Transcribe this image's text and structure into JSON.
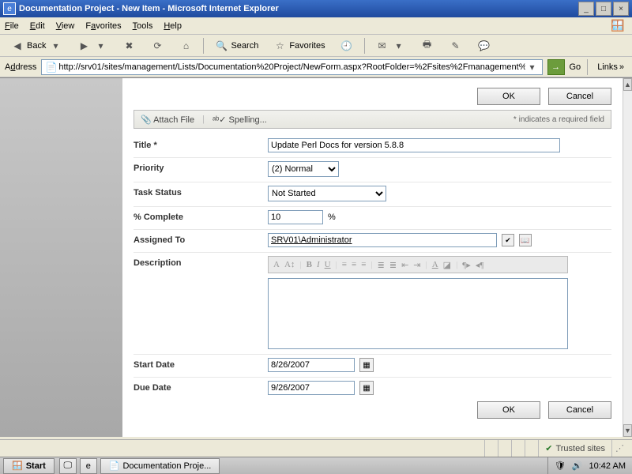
{
  "window": {
    "title": "Documentation Project - New Item - Microsoft Internet Explorer"
  },
  "menubar": {
    "file": "File",
    "edit": "Edit",
    "view": "View",
    "favorites": "Favorites",
    "tools": "Tools",
    "help": "Help"
  },
  "toolbar": {
    "back": "Back",
    "search": "Search",
    "favorites": "Favorites"
  },
  "addressbar": {
    "label": "Address",
    "url": "http://srv01/sites/management/Lists/Documentation%20Project/NewForm.aspx?RootFolder=%2Fsites%2Fmanagement%2F",
    "go": "Go",
    "links": "Links"
  },
  "form": {
    "ok": "OK",
    "cancel": "Cancel",
    "attach": "Attach File",
    "spelling": "Spelling...",
    "required_note": "* indicates a required field",
    "fields": {
      "title_label": "Title *",
      "title_value": "Update Perl Docs for version 5.8.8",
      "priority_label": "Priority",
      "priority_value": "(2) Normal",
      "status_label": "Task Status",
      "status_value": "Not Started",
      "pct_label": "% Complete",
      "pct_value": "10",
      "pct_suffix": "%",
      "assigned_label": "Assigned To",
      "assigned_value": "SRV01\\Administrator",
      "desc_label": "Description",
      "start_label": "Start Date",
      "start_value": "8/26/2007",
      "due_label": "Due Date",
      "due_value": "9/26/2007"
    }
  },
  "statusbar": {
    "trusted": "Trusted sites"
  },
  "taskbar": {
    "start": "Start",
    "item1": "Documentation Proje...",
    "clock": "10:42 AM"
  }
}
